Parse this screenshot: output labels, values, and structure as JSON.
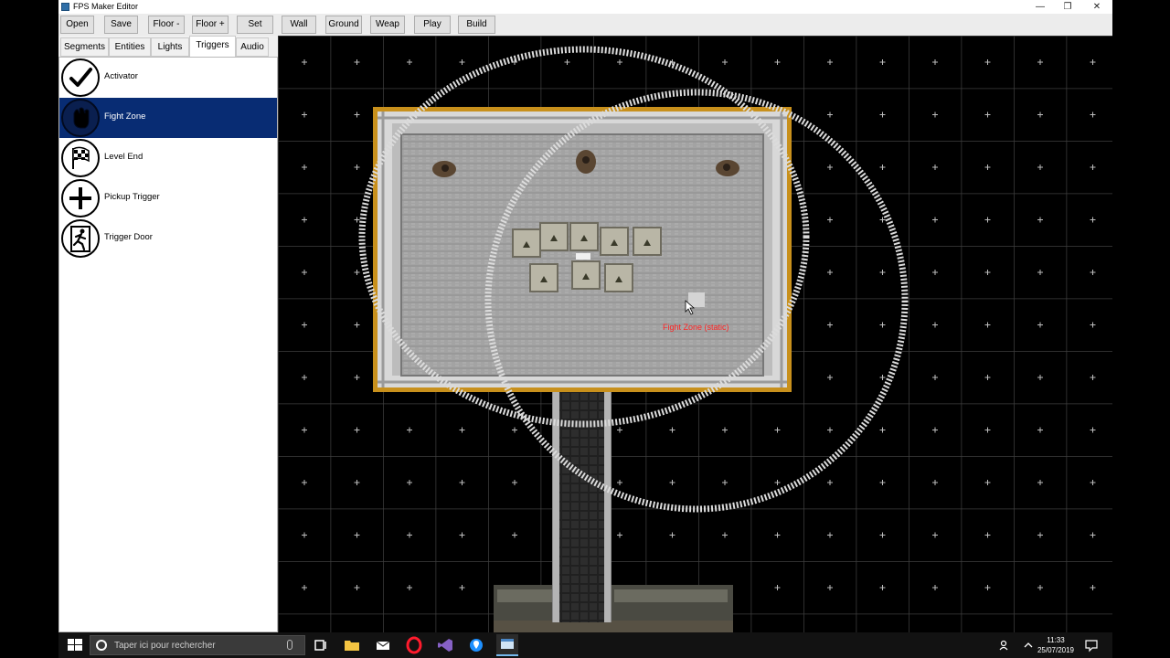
{
  "window": {
    "title": "FPS Maker Editor",
    "minimize": "—",
    "maximize": "❐",
    "close": "✕"
  },
  "toolbar": {
    "buttons": [
      "Open",
      "Save",
      "Floor -",
      "Floor +",
      "Set",
      "Wall",
      "Ground",
      "Weap",
      "Play",
      "Build"
    ]
  },
  "tabs": {
    "labels": [
      "Segments",
      "Entities",
      "Lights",
      "Triggers",
      "Audio"
    ],
    "active": "Triggers"
  },
  "triggers": {
    "items": [
      {
        "label": "Activator",
        "icon": "checkmark-icon"
      },
      {
        "label": "Fight Zone",
        "icon": "fist-icon",
        "selected": true
      },
      {
        "label": "Level End",
        "icon": "checkered-flag-icon"
      },
      {
        "label": "Pickup Trigger",
        "icon": "plus-icon"
      },
      {
        "label": "Trigger Door",
        "icon": "running-man-icon"
      }
    ]
  },
  "viewport": {
    "zone_label": "Fight Zone (static)",
    "accent": "#c8901c",
    "zone_color": "#ff2222"
  },
  "taskbar": {
    "search_placeholder": "Taper ici pour rechercher",
    "time": "11:33",
    "date": "25/07/2019"
  }
}
